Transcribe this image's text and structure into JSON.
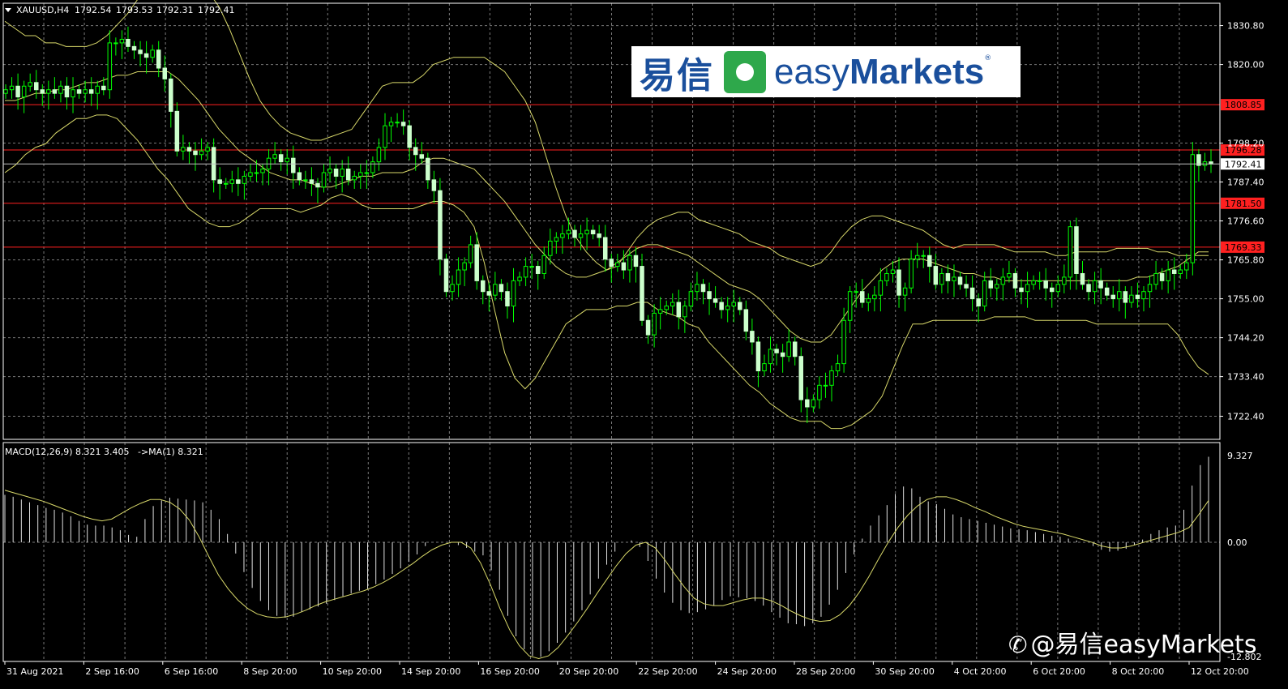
{
  "header": {
    "symbol_label": "XAUUSD,H4",
    "open": "1792.54",
    "high": "1793.53",
    "low": "1792.31",
    "close": "1792.41",
    "menu_icon": "triangle-down-icon"
  },
  "macd_header": {
    "label": "MACD(12,26,9) 8.321 3.405",
    "ma_label": "->MA(1) 8.321"
  },
  "logo": {
    "cn": "易信",
    "easy": "easy",
    "markets": "Markets",
    "reg": "®"
  },
  "watermark": {
    "icon": "weibo-icon",
    "text": "@易信easyMarkets"
  },
  "colors": {
    "background": "#000000",
    "grid": "#7a7a7a",
    "bull_candle": "#00ff00",
    "bear_candle": "#ccffcc",
    "bands": "#d8d86a",
    "level_line": "#ff2020",
    "macd_hist": "#e0e0e0",
    "signal": "#d8d86a",
    "text": "#ffffff"
  },
  "chart_data": {
    "type": "line",
    "symbol": "XAUUSD",
    "timeframe": "H4",
    "price_axis": {
      "ylim": [
        1716.0,
        1837.0
      ],
      "ticks": [
        "1830.80",
        "1820.00",
        "1798.20",
        "1787.40",
        "1776.60",
        "1765.80",
        "1755.00",
        "1744.20",
        "1733.40",
        "1722.40"
      ]
    },
    "current_price": "1792.41",
    "levels": [
      {
        "label": "1808.85",
        "value": 1808.85
      },
      {
        "label": "1796.28",
        "value": 1796.28
      },
      {
        "label": "1781.50",
        "value": 1781.5
      },
      {
        "label": "1769.33",
        "value": 1769.33
      }
    ],
    "x_labels": [
      "31 Aug 2021",
      "2 Sep 16:00",
      "6 Sep 16:00",
      "8 Sep 20:00",
      "10 Sep 20:00",
      "14 Sep 20:00",
      "16 Sep 20:00",
      "20 Sep 20:00",
      "22 Sep 20:00",
      "24 Sep 20:00",
      "28 Sep 20:00",
      "30 Sep 20:00",
      "4 Oct 20:00",
      "6 Oct 20:00",
      "8 Oct 20:00",
      "12 Oct 20:00"
    ],
    "close_series": [
      1813,
      1814,
      1811,
      1814,
      1815,
      1813,
      1812,
      1813,
      1812,
      1814,
      1811,
      1813,
      1812,
      1813,
      1812,
      1814,
      1813,
      1826,
      1826,
      1827,
      1825,
      1824,
      1823,
      1822,
      1824,
      1819,
      1816,
      1807,
      1796,
      1797,
      1796,
      1795,
      1796,
      1797,
      1788,
      1787,
      1787,
      1788,
      1787,
      1789,
      1790,
      1790,
      1791,
      1794,
      1795,
      1793,
      1794,
      1790,
      1788,
      1788,
      1787,
      1786,
      1790,
      1791,
      1789,
      1791,
      1788,
      1789,
      1790,
      1790,
      1793,
      1797,
      1803,
      1804,
      1804,
      1803,
      1797,
      1795,
      1794,
      1788,
      1785,
      1766,
      1757,
      1759,
      1763,
      1765,
      1770,
      1760,
      1757,
      1756,
      1759,
      1757,
      1753,
      1760,
      1761,
      1764,
      1764,
      1762,
      1767,
      1771,
      1772,
      1773,
      1774,
      1772,
      1773,
      1774,
      1773,
      1772,
      1766,
      1764,
      1765,
      1763,
      1767,
      1764,
      1749,
      1745,
      1751,
      1752,
      1753,
      1754,
      1750,
      1753,
      1757,
      1759,
      1757,
      1755,
      1754,
      1752,
      1753,
      1754,
      1752,
      1746,
      1743,
      1735,
      1737,
      1741,
      1740,
      1739,
      1743,
      1739,
      1727,
      1725,
      1727,
      1731,
      1731,
      1735,
      1737,
      1749,
      1757,
      1757,
      1754,
      1755,
      1756,
      1760,
      1762,
      1763,
      1756,
      1758,
      1766,
      1767,
      1767,
      1764,
      1759,
      1762,
      1760,
      1761,
      1759,
      1758,
      1755,
      1753,
      1760,
      1758,
      1759,
      1761,
      1762,
      1758,
      1757,
      1759,
      1760,
      1760,
      1758,
      1757,
      1759,
      1761,
      1775,
      1762,
      1759,
      1757,
      1760,
      1758,
      1756,
      1755,
      1757,
      1754,
      1756,
      1755,
      1757,
      1759,
      1762,
      1760,
      1763,
      1762,
      1763,
      1765,
      1795,
      1792,
      1793,
      1792.41
    ],
    "bands_upper": [
      1832,
      1830,
      1828,
      1828,
      1826,
      1826,
      1825,
      1825,
      1825,
      1826,
      1828,
      1831,
      1834,
      1838,
      1842,
      1845,
      1847,
      1848,
      1847,
      1844,
      1840,
      1836,
      1830,
      1823,
      1816,
      1810,
      1806,
      1803,
      1801,
      1800,
      1799,
      1799,
      1800,
      1801,
      1802,
      1806,
      1810,
      1814,
      1815,
      1815,
      1815,
      1817,
      1820,
      1821,
      1822,
      1822,
      1822,
      1822,
      1820,
      1818,
      1814,
      1810,
      1804,
      1795,
      1786,
      1778,
      1772,
      1768,
      1765,
      1763,
      1764,
      1768,
      1772,
      1775,
      1777,
      1778,
      1779,
      1779,
      1777,
      1776,
      1775,
      1774,
      1773,
      1771,
      1770,
      1769,
      1767,
      1766,
      1765,
      1764,
      1765,
      1768,
      1772,
      1775,
      1777,
      1778,
      1778,
      1777,
      1776,
      1775,
      1774,
      1772,
      1770,
      1769,
      1770,
      1770,
      1770,
      1770,
      1769,
      1768,
      1768,
      1768,
      1768,
      1767,
      1767,
      1768,
      1768,
      1768,
      1768,
      1769,
      1769,
      1769,
      1769,
      1768,
      1768,
      1767,
      1767,
      1767,
      1767
    ],
    "bands_mid": [
      1810,
      1810,
      1811,
      1812,
      1812,
      1813,
      1813,
      1814,
      1815,
      1815,
      1816,
      1817,
      1817,
      1818,
      1818,
      1818,
      1818,
      1816,
      1813,
      1810,
      1806,
      1802,
      1799,
      1796,
      1794,
      1792,
      1790,
      1789,
      1788,
      1788,
      1787,
      1786,
      1786,
      1787,
      1788,
      1789,
      1789,
      1790,
      1790,
      1790,
      1791,
      1793,
      1794,
      1794,
      1793,
      1792,
      1791,
      1788,
      1785,
      1782,
      1778,
      1774,
      1770,
      1767,
      1764,
      1762,
      1761,
      1761,
      1762,
      1763,
      1765,
      1767,
      1769,
      1770,
      1770,
      1769,
      1768,
      1767,
      1765,
      1763,
      1761,
      1759,
      1758,
      1757,
      1755,
      1752,
      1749,
      1746,
      1744,
      1743,
      1743,
      1745,
      1749,
      1753,
      1757,
      1760,
      1763,
      1765,
      1766,
      1766,
      1766,
      1765,
      1764,
      1763,
      1762,
      1762,
      1761,
      1761,
      1760,
      1760,
      1760,
      1760,
      1760,
      1760,
      1760,
      1760,
      1760,
      1760,
      1760,
      1760,
      1760,
      1761,
      1761,
      1762,
      1763,
      1764,
      1766,
      1768,
      1768
    ],
    "bands_lower": [
      1790,
      1792,
      1795,
      1797,
      1798,
      1801,
      1803,
      1805,
      1805,
      1806,
      1806,
      1805,
      1802,
      1799,
      1795,
      1791,
      1788,
      1784,
      1780,
      1778,
      1776,
      1775,
      1775,
      1776,
      1778,
      1780,
      1780,
      1780,
      1780,
      1779,
      1780,
      1781,
      1783,
      1784,
      1783,
      1781,
      1780,
      1780,
      1780,
      1780,
      1780,
      1781,
      1782,
      1782,
      1781,
      1779,
      1775,
      1765,
      1752,
      1740,
      1733,
      1730,
      1733,
      1738,
      1743,
      1748,
      1750,
      1752,
      1752,
      1752,
      1753,
      1753,
      1754,
      1754,
      1752,
      1751,
      1750,
      1748,
      1747,
      1743,
      1740,
      1737,
      1734,
      1731,
      1729,
      1726,
      1724,
      1722,
      1721,
      1721,
      1721,
      1719,
      1719,
      1720,
      1722,
      1724,
      1728,
      1735,
      1742,
      1748,
      1748,
      1749,
      1749,
      1749,
      1749,
      1749,
      1749,
      1750,
      1750,
      1750,
      1750,
      1749,
      1749,
      1749,
      1749,
      1749,
      1749,
      1748,
      1748,
      1748,
      1748,
      1748,
      1748,
      1748,
      1748,
      1745,
      1740,
      1736,
      1734
    ],
    "macd": {
      "ylim": [
        -12.802,
        9.327
      ],
      "ticks": [
        "9.327",
        "0.00",
        "-12.802"
      ],
      "histogram": [
        5.1,
        4.9,
        4.6,
        4.3,
        4.0,
        3.7,
        3.5,
        3.2,
        2.8,
        2.3,
        1.9,
        1.8,
        1.8,
        1.6,
        1.3,
        0.8,
        0.6,
        2.5,
        3.9,
        4.5,
        4.8,
        4.7,
        4.6,
        4.5,
        4.3,
        3.5,
        2.5,
        0.9,
        -1.2,
        -3.2,
        -4.9,
        -6.3,
        -7.3,
        -7.9,
        -8.1,
        -8.0,
        -7.5,
        -7.2,
        -6.9,
        -6.6,
        -6.2,
        -5.8,
        -5.5,
        -5.2,
        -5.0,
        -4.5,
        -4.0,
        -3.4,
        -2.8,
        -2.1,
        -1.3,
        -0.4,
        0.0,
        0.0,
        -0.1,
        -0.3,
        -0.6,
        -1.0,
        -1.4,
        -3.0,
        -5.1,
        -7.9,
        -10.1,
        -11.5,
        -12.2,
        -12.3,
        -11.7,
        -10.8,
        -9.7,
        -8.5,
        -7.3,
        -5.6,
        -3.9,
        -2.4,
        -1.0,
        0.0,
        0.2,
        -0.5,
        -2.0,
        -3.9,
        -5.4,
        -6.5,
        -7.3,
        -7.6,
        -7.5,
        -7.2,
        -6.8,
        -6.2,
        -5.8,
        -5.9,
        -6.0,
        -6.3,
        -6.8,
        -7.5,
        -8.1,
        -8.7,
        -8.8,
        -9.0,
        -8.7,
        -8.0,
        -6.7,
        -5.1,
        -3.3,
        -1.3,
        0.4,
        1.8,
        2.9,
        4.0,
        5.2,
        6.0,
        5.8,
        4.9,
        4.4,
        4.1,
        3.6,
        3.0,
        2.7,
        2.5,
        2.3,
        2.1,
        1.9,
        1.7,
        1.5,
        1.4,
        1.3,
        1.1,
        0.9,
        0.7,
        0.6,
        0.4,
        0.2,
        0.0,
        -0.4,
        -0.8,
        -1.0,
        -0.9,
        -0.7,
        -0.3,
        0.3,
        0.9,
        1.3,
        1.6,
        1.8,
        3.5,
        6.1,
        8.3,
        9.2
      ],
      "signal": [
        5.6,
        5.3,
        5.0,
        4.7,
        4.4,
        4.0,
        3.6,
        3.2,
        2.8,
        2.5,
        2.3,
        2.5,
        3.1,
        3.7,
        4.2,
        4.6,
        4.6,
        4.3,
        3.6,
        2.4,
        0.6,
        -1.5,
        -3.5,
        -5.0,
        -6.2,
        -7.1,
        -7.7,
        -8.0,
        -8.1,
        -8.0,
        -7.7,
        -7.3,
        -6.8,
        -6.4,
        -6.1,
        -5.8,
        -5.5,
        -5.2,
        -4.8,
        -4.3,
        -3.7,
        -3.0,
        -2.3,
        -1.5,
        -0.8,
        -0.3,
        0.0,
        0.0,
        -0.6,
        -2.2,
        -4.5,
        -7.1,
        -9.4,
        -11.1,
        -12.2,
        -12.5,
        -12.2,
        -11.3,
        -10.0,
        -8.6,
        -7.1,
        -5.5,
        -4.0,
        -2.5,
        -1.2,
        -0.3,
        0.0,
        -0.6,
        -1.9,
        -3.4,
        -4.8,
        -6.0,
        -6.6,
        -6.8,
        -6.8,
        -6.5,
        -6.2,
        -6.0,
        -6.0,
        -6.3,
        -6.8,
        -7.4,
        -7.9,
        -8.3,
        -8.5,
        -8.4,
        -7.8,
        -6.8,
        -5.4,
        -3.7,
        -1.8,
        0.0,
        1.6,
        2.9,
        3.9,
        4.6,
        4.9,
        4.9,
        4.6,
        4.2,
        3.7,
        3.3,
        2.8,
        2.4,
        2.0,
        1.7,
        1.5,
        1.3,
        1.1,
        0.9,
        0.6,
        0.3,
        0.0,
        -0.4,
        -0.6,
        -0.6,
        -0.4,
        -0.1,
        0.2,
        0.5,
        0.8,
        1.1,
        1.6,
        3.0,
        4.5
      ]
    }
  }
}
